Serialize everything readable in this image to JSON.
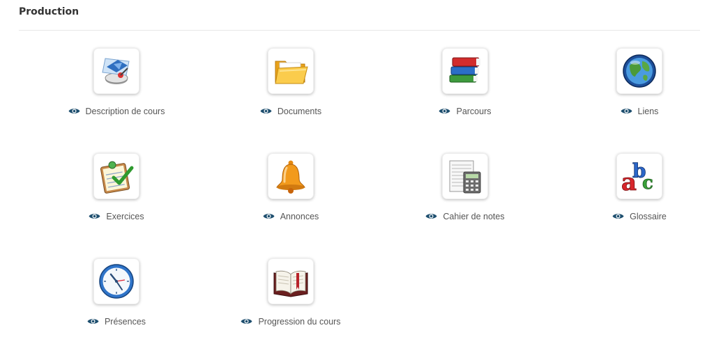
{
  "section": {
    "title": "Production"
  },
  "tools": [
    {
      "label": "Description de cours",
      "icon": "compass-icon"
    },
    {
      "label": "Documents",
      "icon": "folder-icon"
    },
    {
      "label": "Parcours",
      "icon": "books-icon"
    },
    {
      "label": "Liens",
      "icon": "globe-icon"
    },
    {
      "label": "Exercices",
      "icon": "checklist-icon"
    },
    {
      "label": "Annonces",
      "icon": "bell-icon"
    },
    {
      "label": "Cahier de notes",
      "icon": "gradebook-calculator-icon"
    },
    {
      "label": "Glossaire",
      "icon": "abc-icon"
    },
    {
      "label": "Présences",
      "icon": "clock-icon"
    },
    {
      "label": "Progression du cours",
      "icon": "open-book-icon"
    }
  ],
  "visibility_icon": "eye-icon",
  "colors": {
    "title": "#333333",
    "caption": "#555555",
    "eye": "#1e4f6f",
    "divider": "#e8e8e8"
  }
}
